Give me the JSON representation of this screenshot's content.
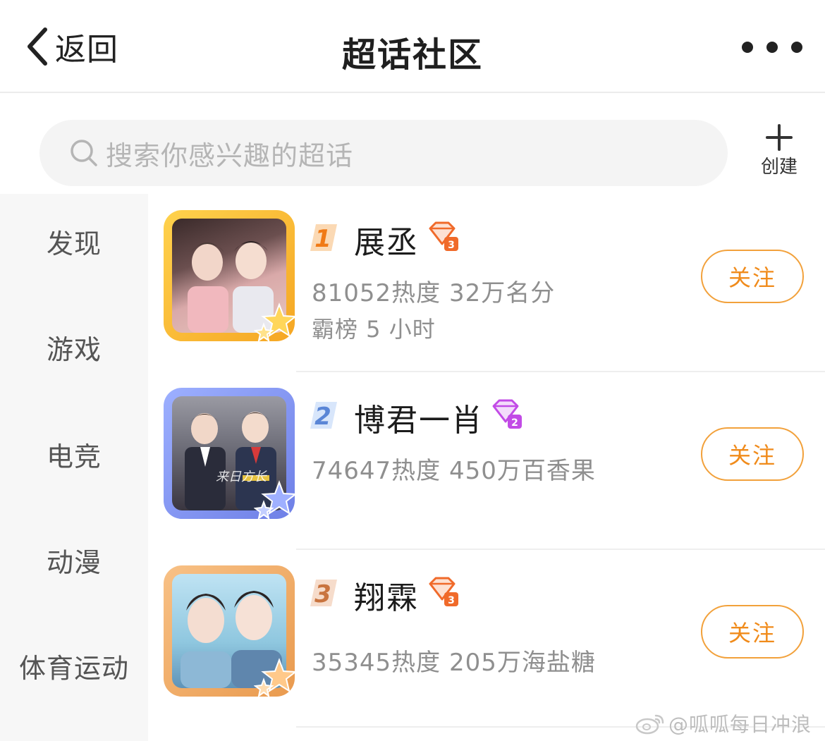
{
  "header": {
    "back_label": "返回",
    "title": "超话社区",
    "more_icon": "more-dots-icon"
  },
  "search": {
    "placeholder": "搜索你感兴趣的超话",
    "icon": "search-icon"
  },
  "create": {
    "label": "创建",
    "icon": "plus-icon"
  },
  "sidebar": {
    "items": [
      {
        "label": "发现"
      },
      {
        "label": "游戏"
      },
      {
        "label": "电竞"
      },
      {
        "label": "动漫"
      },
      {
        "label": "体育运动"
      }
    ]
  },
  "list": {
    "items": [
      {
        "rank": "1",
        "name": "展丞",
        "stats": "81052热度 32万名分",
        "sub": "霸榜 5 小时",
        "follow_label": "关注",
        "frame_color": "#f7b733",
        "badge_color": "#f06a2a"
      },
      {
        "rank": "2",
        "name": "博君一肖",
        "stats": "74647热度 450万百香果",
        "sub": "",
        "follow_label": "关注",
        "frame_color": "#7d8ff0",
        "badge_color": "#c24be6"
      },
      {
        "rank": "3",
        "name": "翔霖",
        "stats": "35345热度 205万海盐糖",
        "sub": "",
        "follow_label": "关注",
        "frame_color": "#f2a866",
        "badge_color": "#f06a2a"
      }
    ]
  },
  "watermark": "@呱呱每日冲浪",
  "colors": {
    "accent": "#f08b1b",
    "follow_border": "#f2a13b",
    "muted_text": "#8f8f8f",
    "sidebar_bg": "#f7f7f7"
  }
}
